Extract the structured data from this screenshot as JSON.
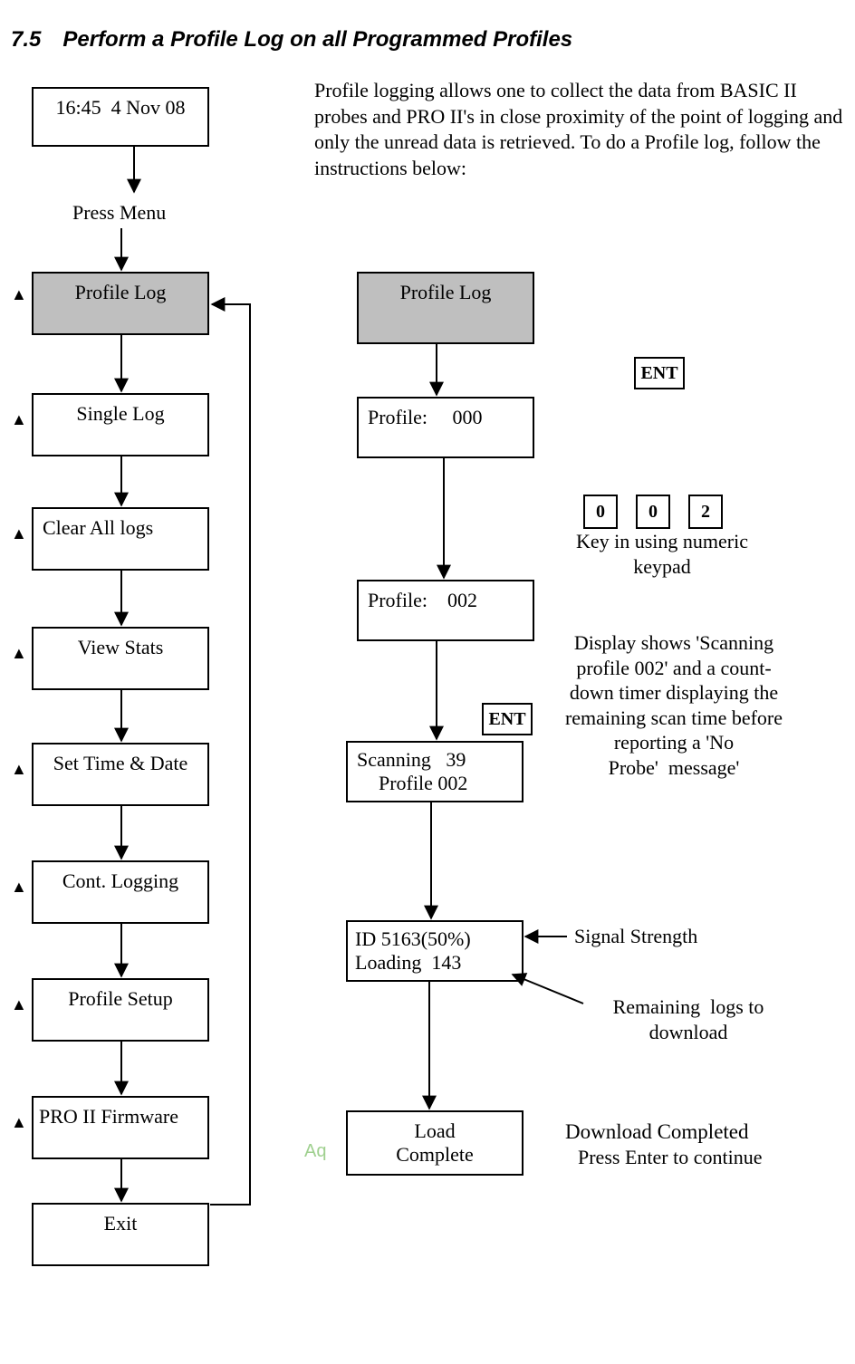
{
  "heading": "7.5 Perform a Profile Log on all Programmed Profiles",
  "intro": "Profile logging allows one to collect the data from BASIC II probes and PRO II's in close proximity of the point of logging and only the unread data is retrieved.  To do a Profile log, follow the instructions below:",
  "left": {
    "time_box": "16:45  4 Nov 08",
    "press_menu": "Press Menu",
    "items": [
      "Profile Log",
      "Single Log",
      "Clear All logs",
      "View Stats",
      "Set Time & Date",
      "Cont. Logging",
      "Profile Setup",
      "PRO II Firmware",
      "Exit"
    ]
  },
  "right": {
    "profile_log": "Profile Log",
    "profile_initial": "Profile:     000",
    "profile_entered": "Profile:    002",
    "scanning_l1": "Scanning   39",
    "scanning_l2": "Profile 002",
    "id_l1": "ID 5163(50%)",
    "id_l2": "Loading  143",
    "load_l1": "Load",
    "load_l2": "Complete",
    "ent": "ENT",
    "keys": [
      "0",
      "0",
      "2"
    ],
    "keypad_note": "Key in using numeric\nkeypad",
    "scan_note": "Display shows 'Scanning profile 002' and a count-down timer displaying the remaining scan time before reporting a 'No Probe'  message'",
    "signal": "Signal Strength",
    "remaining": "Remaining  logs to\ndownload",
    "complete_l1": "Download Completed",
    "complete_l2": "Press Enter to continue"
  },
  "watermark": "Aq"
}
